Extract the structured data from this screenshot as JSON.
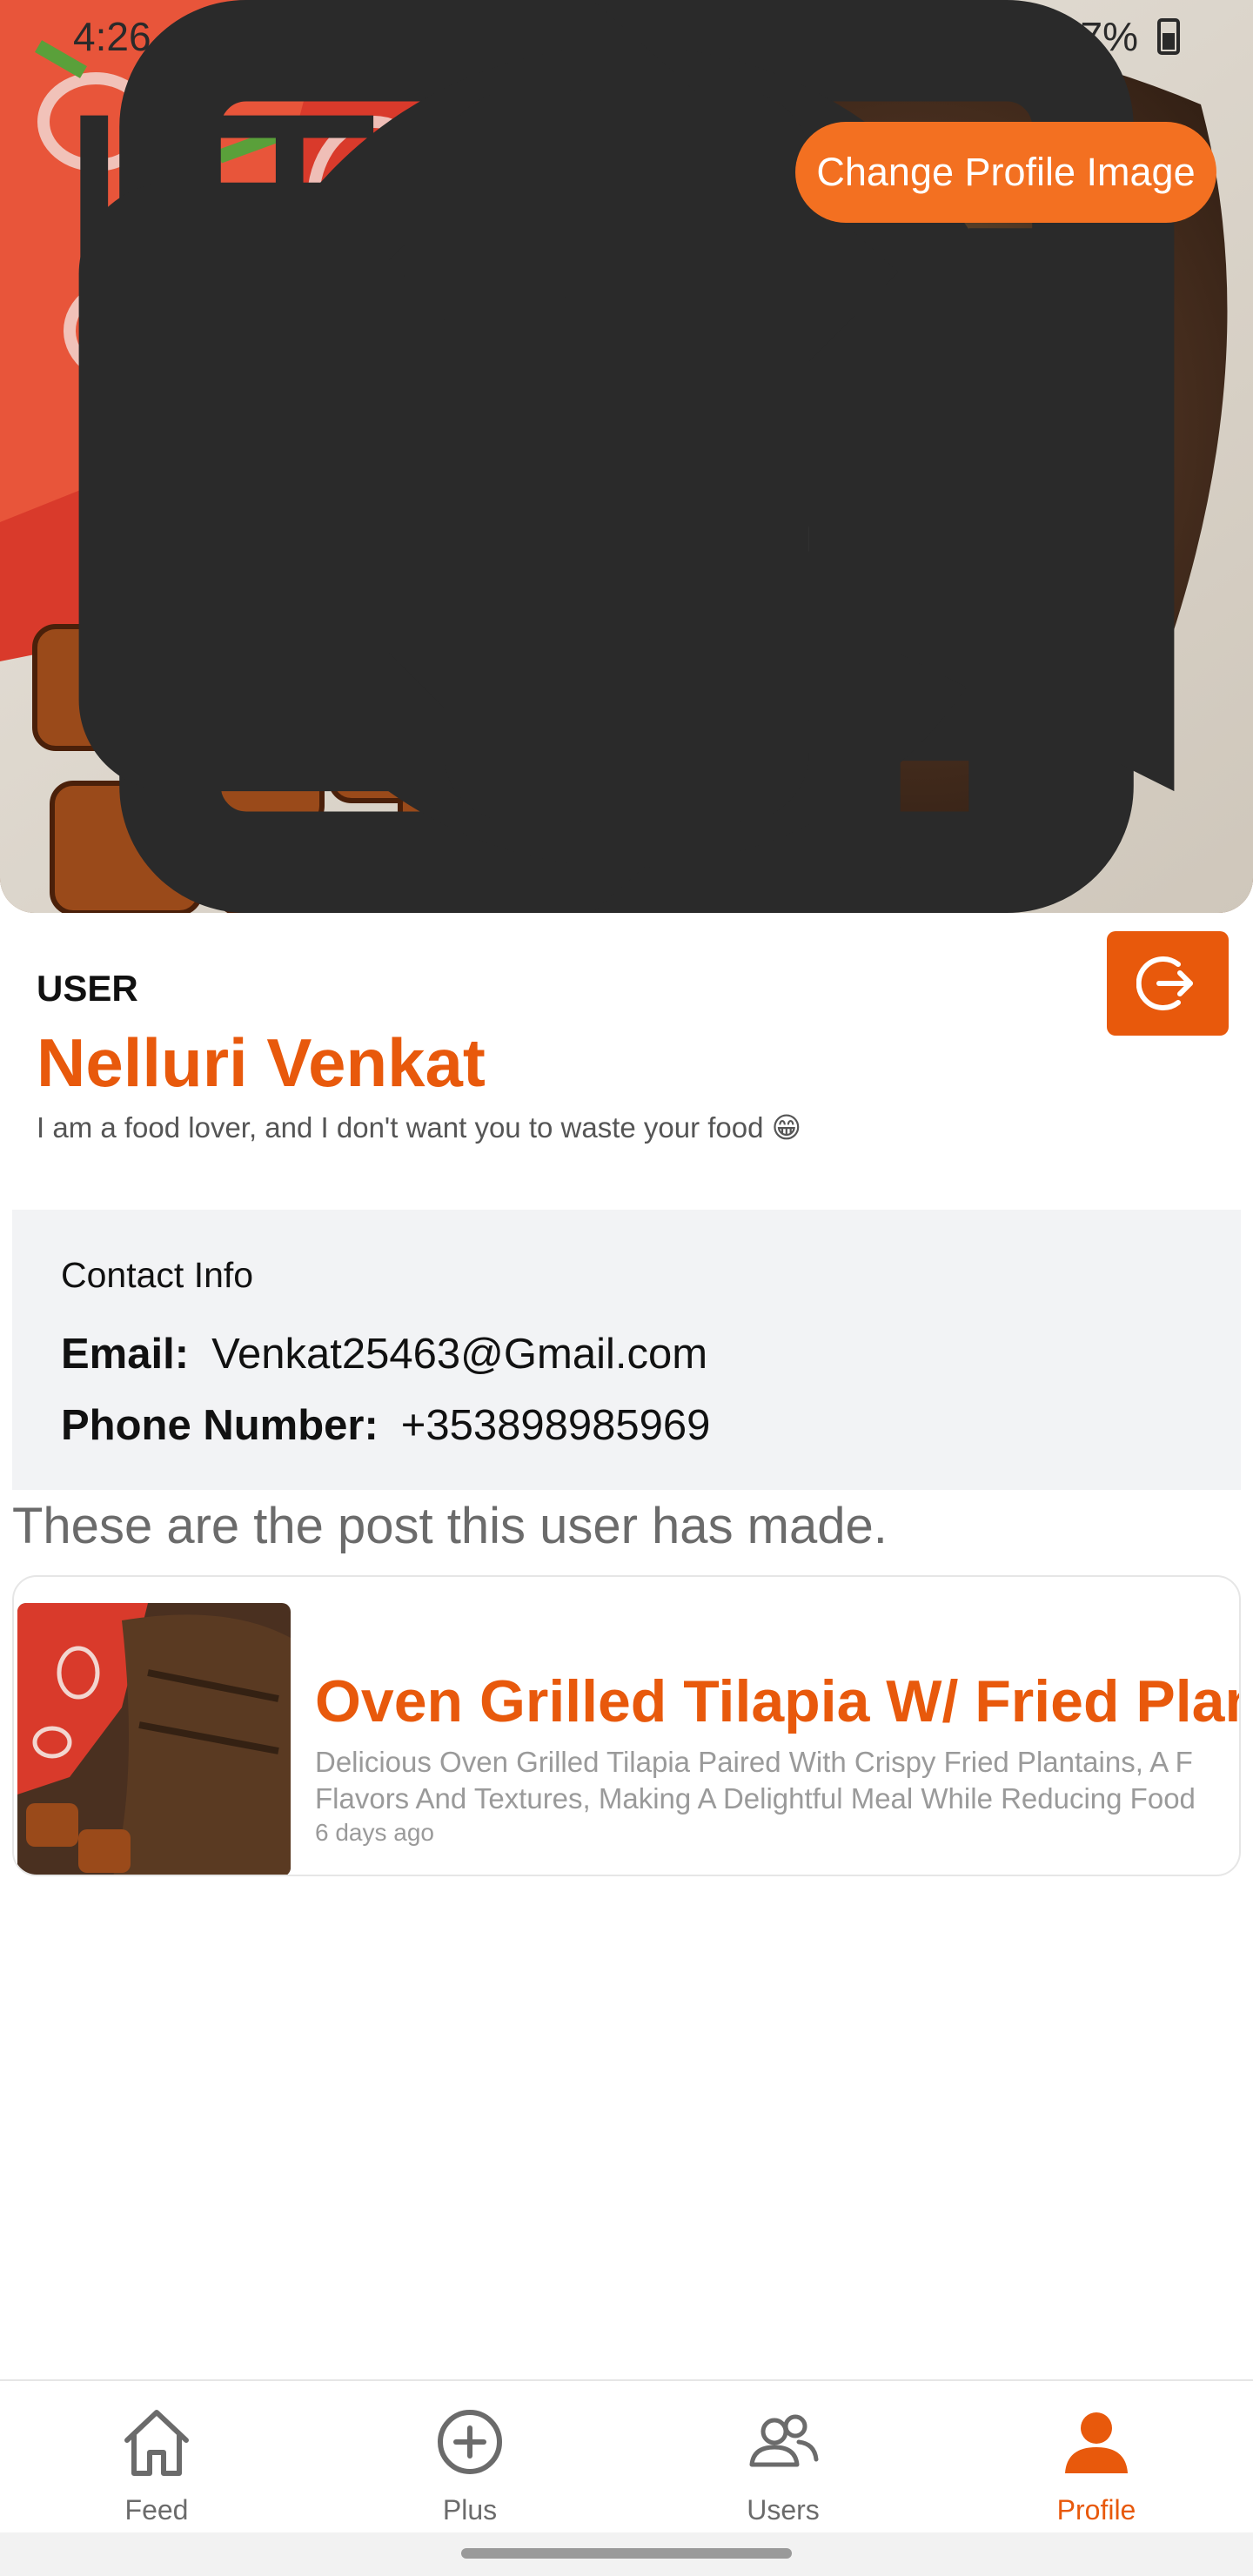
{
  "status_bar": {
    "time": "4:26",
    "battery": "47%"
  },
  "hero": {
    "change_image_label": "Change Profile Image"
  },
  "profile": {
    "role": "USER",
    "name": "Nelluri Venkat",
    "bio": "I am a food lover, and I don't want you to waste your food 😁"
  },
  "contact": {
    "title": "Contact Info",
    "email_label": "Email:",
    "email": "Venkat25463@Gmail.com",
    "phone_label": "Phone Number:",
    "phone": "+353898985969"
  },
  "posts_heading": "These are the post this user has made.",
  "posts": [
    {
      "title": "Oven Grilled Tilapia W/ Fried Plan",
      "desc_line1": "Delicious Oven Grilled Tilapia Paired With Crispy Fried Plantains, A F",
      "desc_line2": "Flavors And Textures, Making A Delightful Meal While Reducing Food",
      "time": "6 days ago"
    }
  ],
  "nav": {
    "items": [
      {
        "label": "Feed",
        "icon": "home-icon"
      },
      {
        "label": "Plus",
        "icon": "plus-circle-icon"
      },
      {
        "label": "Users",
        "icon": "users-icon"
      },
      {
        "label": "Profile",
        "icon": "person-icon"
      }
    ],
    "active": "Profile"
  },
  "colors": {
    "accent": "#e8590c",
    "button_orange": "#f37021",
    "panel": "#f2f3f5"
  }
}
